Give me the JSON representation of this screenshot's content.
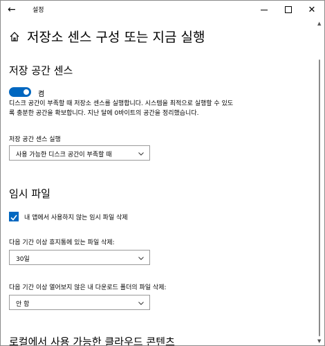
{
  "window": {
    "title": "설정",
    "back_glyph": "←",
    "controls": {
      "minimize": "minimize",
      "maximize": "maximize",
      "close": "✕"
    }
  },
  "page": {
    "title": "저장소 센스 구성 또는 지금 실행",
    "icon": "home-icon"
  },
  "storage_sense": {
    "heading": "저장 공간 센스",
    "toggle_state": "켬",
    "toggle_on": true,
    "description": "디스크 공간이 부족할 때 저장소 센스를 실행합니다. 시스템을 최적으로 실행할 수 있도록 충분한 공간을 확보합니다. 지난 달에 0바이트의 공간을 정리했습니다.",
    "run_label": "저장 공간 센스 실행",
    "run_value": "사용 가능한 디스크 공간이 부족할 때"
  },
  "temp_files": {
    "heading": "임시 파일",
    "delete_temp_label": "내 앱에서 사용하지 않는 임시 파일 삭제",
    "delete_temp_checked": true,
    "recycle_label": "다음 기간 이상 휴지통에 있는 파일 삭제:",
    "recycle_value": "30일",
    "downloads_label": "다음 기간 이상 열어보지 않은 내 다운로드 폴더의 파일 삭제:",
    "downloads_value": "안 함"
  },
  "cloud": {
    "heading": "로컬에서 사용 가능한 클라우드 콘텐츠"
  },
  "colors": {
    "accent": "#0067c0"
  }
}
